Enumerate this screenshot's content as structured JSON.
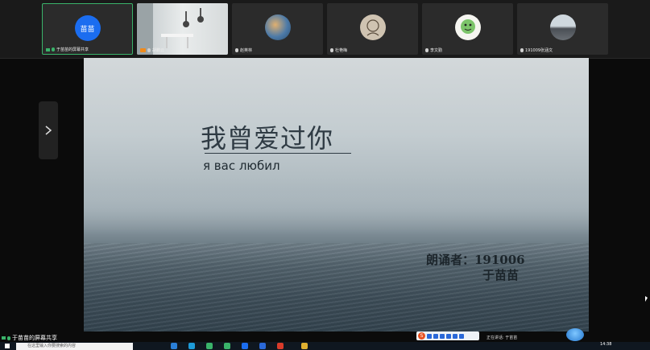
{
  "participants": [
    {
      "name": "于苗苗的屏幕共享",
      "avatar_text": "苗苗",
      "avatar_color": "#1b6df0",
      "active": true,
      "sharing": true
    },
    {
      "name": "胡鹏云",
      "avatar_icon": "room-photo-icon",
      "host": true
    },
    {
      "name": "赵英林",
      "avatar_icon": "painting-avatar-icon"
    },
    {
      "name": "杜艳梅",
      "avatar_icon": "sketch-avatar-icon"
    },
    {
      "name": "李文勤",
      "avatar_icon": "cartoon-avatar-icon"
    },
    {
      "name": "191009张涵文",
      "avatar_icon": "landscape-avatar-icon"
    }
  ],
  "slide": {
    "title_zh": "我曾爱过你",
    "title_ru": "я вас любил",
    "reader_label": "朗诵者：191006",
    "reader_name": "于苗苗"
  },
  "share_label": "于苗苗的屏幕共享",
  "ime": {
    "logo": "S"
  },
  "speaking": "正在讲话: 于苗苗",
  "taskbar": {
    "search_placeholder": "在这里输入你要搜索的内容",
    "clock": "14:38"
  },
  "colors": {
    "accent_green": "#3ab36a",
    "avatar_blue": "#1b6df0",
    "host_orange": "#f08a1b"
  }
}
